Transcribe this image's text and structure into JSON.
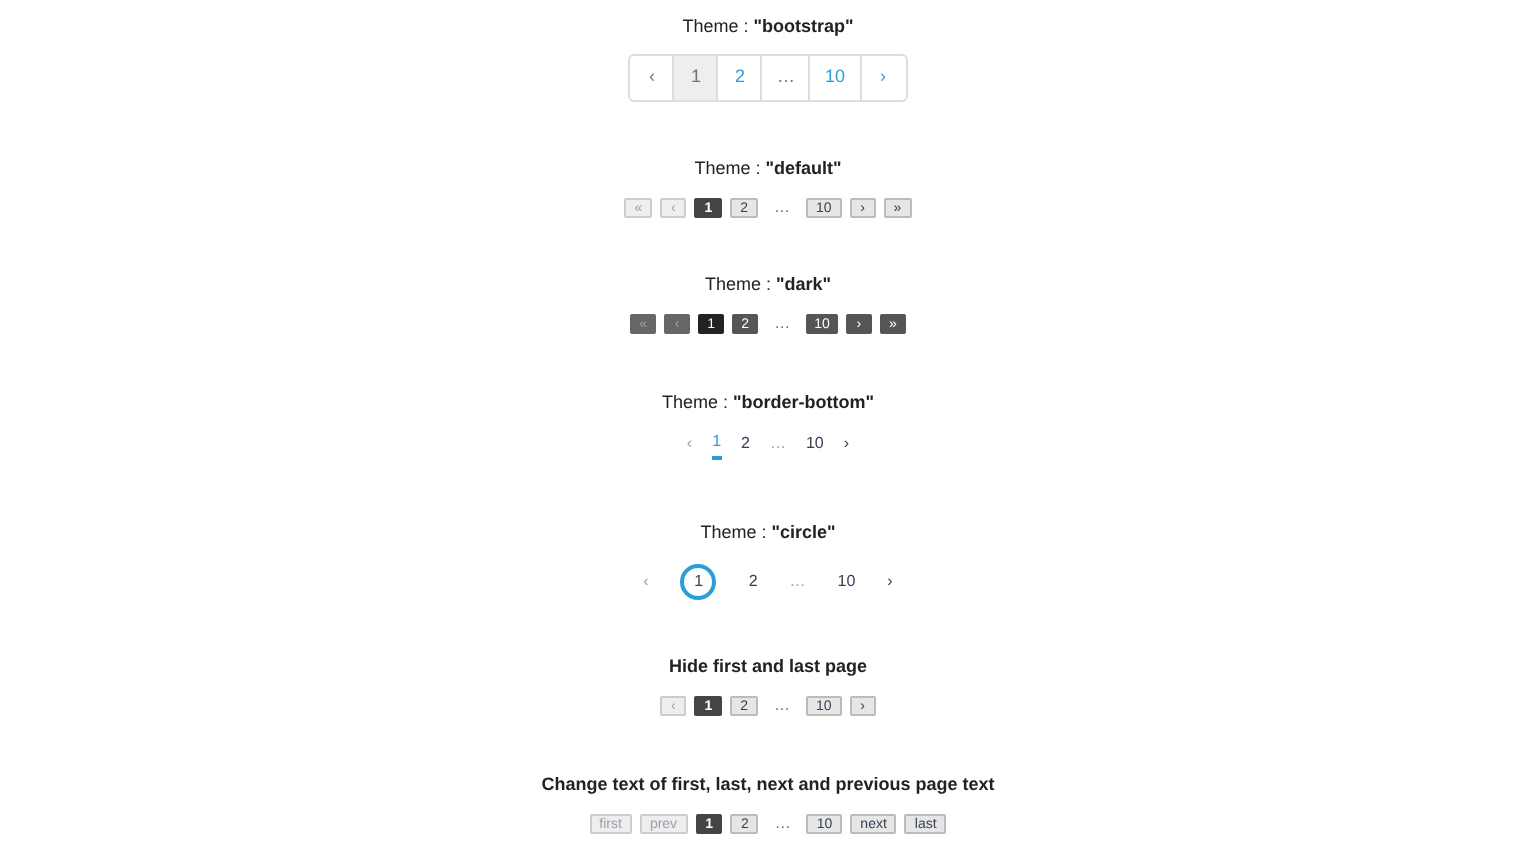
{
  "sections": [
    {
      "title": "Theme : **\"bootstrap\"**",
      "items": [
        {
          "kind": "prev",
          "label": "‹",
          "disabled": true,
          "selected": false
        },
        {
          "kind": "page",
          "label": "1",
          "disabled": false,
          "selected": true
        },
        {
          "kind": "page",
          "label": "2",
          "disabled": false,
          "selected": false
        },
        {
          "kind": "ellipsis",
          "label": "…"
        },
        {
          "kind": "page",
          "label": "10",
          "disabled": false,
          "selected": false
        },
        {
          "kind": "next",
          "label": "›",
          "disabled": false,
          "selected": false
        }
      ]
    },
    {
      "title": "Theme : **\"default\"**",
      "items": [
        {
          "kind": "first",
          "label": "«",
          "disabled": true,
          "selected": false
        },
        {
          "kind": "prev",
          "label": "‹",
          "disabled": true,
          "selected": false
        },
        {
          "kind": "page",
          "label": "1",
          "disabled": false,
          "selected": true
        },
        {
          "kind": "page",
          "label": "2",
          "disabled": false,
          "selected": false
        },
        {
          "kind": "ellipsis",
          "label": "…"
        },
        {
          "kind": "page",
          "label": "10",
          "disabled": false,
          "selected": false
        },
        {
          "kind": "next",
          "label": "›",
          "disabled": false,
          "selected": false
        },
        {
          "kind": "last",
          "label": "»",
          "disabled": false,
          "selected": false
        }
      ]
    },
    {
      "title": "Theme : **\"dark\"**",
      "items": [
        {
          "kind": "first",
          "label": "«",
          "disabled": true,
          "selected": false
        },
        {
          "kind": "prev",
          "label": "‹",
          "disabled": true,
          "selected": false
        },
        {
          "kind": "page",
          "label": "1",
          "disabled": false,
          "selected": true
        },
        {
          "kind": "page",
          "label": "2",
          "disabled": false,
          "selected": false
        },
        {
          "kind": "ellipsis",
          "label": "…"
        },
        {
          "kind": "page",
          "label": "10",
          "disabled": false,
          "selected": false
        },
        {
          "kind": "next",
          "label": "›",
          "disabled": false,
          "selected": false
        },
        {
          "kind": "last",
          "label": "»",
          "disabled": false,
          "selected": false
        }
      ]
    },
    {
      "title": "Theme : **\"border-bottom\"**",
      "items": [
        {
          "kind": "prev",
          "label": "‹",
          "disabled": true,
          "selected": false
        },
        {
          "kind": "page",
          "label": "1",
          "disabled": false,
          "selected": true
        },
        {
          "kind": "page",
          "label": "2",
          "disabled": false,
          "selected": false
        },
        {
          "kind": "ellipsis",
          "label": "…"
        },
        {
          "kind": "page",
          "label": "10",
          "disabled": false,
          "selected": false
        },
        {
          "kind": "next",
          "label": "›",
          "disabled": false,
          "selected": false
        }
      ]
    },
    {
      "title": "Theme : **\"circle\"**",
      "items": [
        {
          "kind": "prev",
          "label": "‹",
          "disabled": true,
          "selected": false
        },
        {
          "kind": "page",
          "label": "1",
          "disabled": false,
          "selected": true
        },
        {
          "kind": "page",
          "label": "2",
          "disabled": false,
          "selected": false
        },
        {
          "kind": "ellipsis",
          "label": "…"
        },
        {
          "kind": "page",
          "label": "10",
          "disabled": false,
          "selected": false
        },
        {
          "kind": "next",
          "label": "›",
          "disabled": false,
          "selected": false
        }
      ]
    },
    {
      "title": "**Hide first and last page**",
      "items": [
        {
          "kind": "prev",
          "label": "‹",
          "disabled": true,
          "selected": false
        },
        {
          "kind": "page",
          "label": "1",
          "disabled": false,
          "selected": true
        },
        {
          "kind": "page",
          "label": "2",
          "disabled": false,
          "selected": false
        },
        {
          "kind": "ellipsis",
          "label": "…"
        },
        {
          "kind": "page",
          "label": "10",
          "disabled": false,
          "selected": false
        },
        {
          "kind": "next",
          "label": "›",
          "disabled": false,
          "selected": false
        }
      ]
    },
    {
      "title": "**Change text of first, last, next and previous page text**",
      "items": [
        {
          "kind": "first",
          "label": "first",
          "disabled": true,
          "selected": false
        },
        {
          "kind": "prev",
          "label": "prev",
          "disabled": true,
          "selected": false
        },
        {
          "kind": "page",
          "label": "1",
          "disabled": false,
          "selected": true
        },
        {
          "kind": "page",
          "label": "2",
          "disabled": false,
          "selected": false
        },
        {
          "kind": "ellipsis",
          "label": "…"
        },
        {
          "kind": "page",
          "label": "10",
          "disabled": false,
          "selected": false
        },
        {
          "kind": "next",
          "label": "next",
          "disabled": false,
          "selected": false
        },
        {
          "kind": "last",
          "label": "last",
          "disabled": false,
          "selected": false
        }
      ]
    }
  ]
}
